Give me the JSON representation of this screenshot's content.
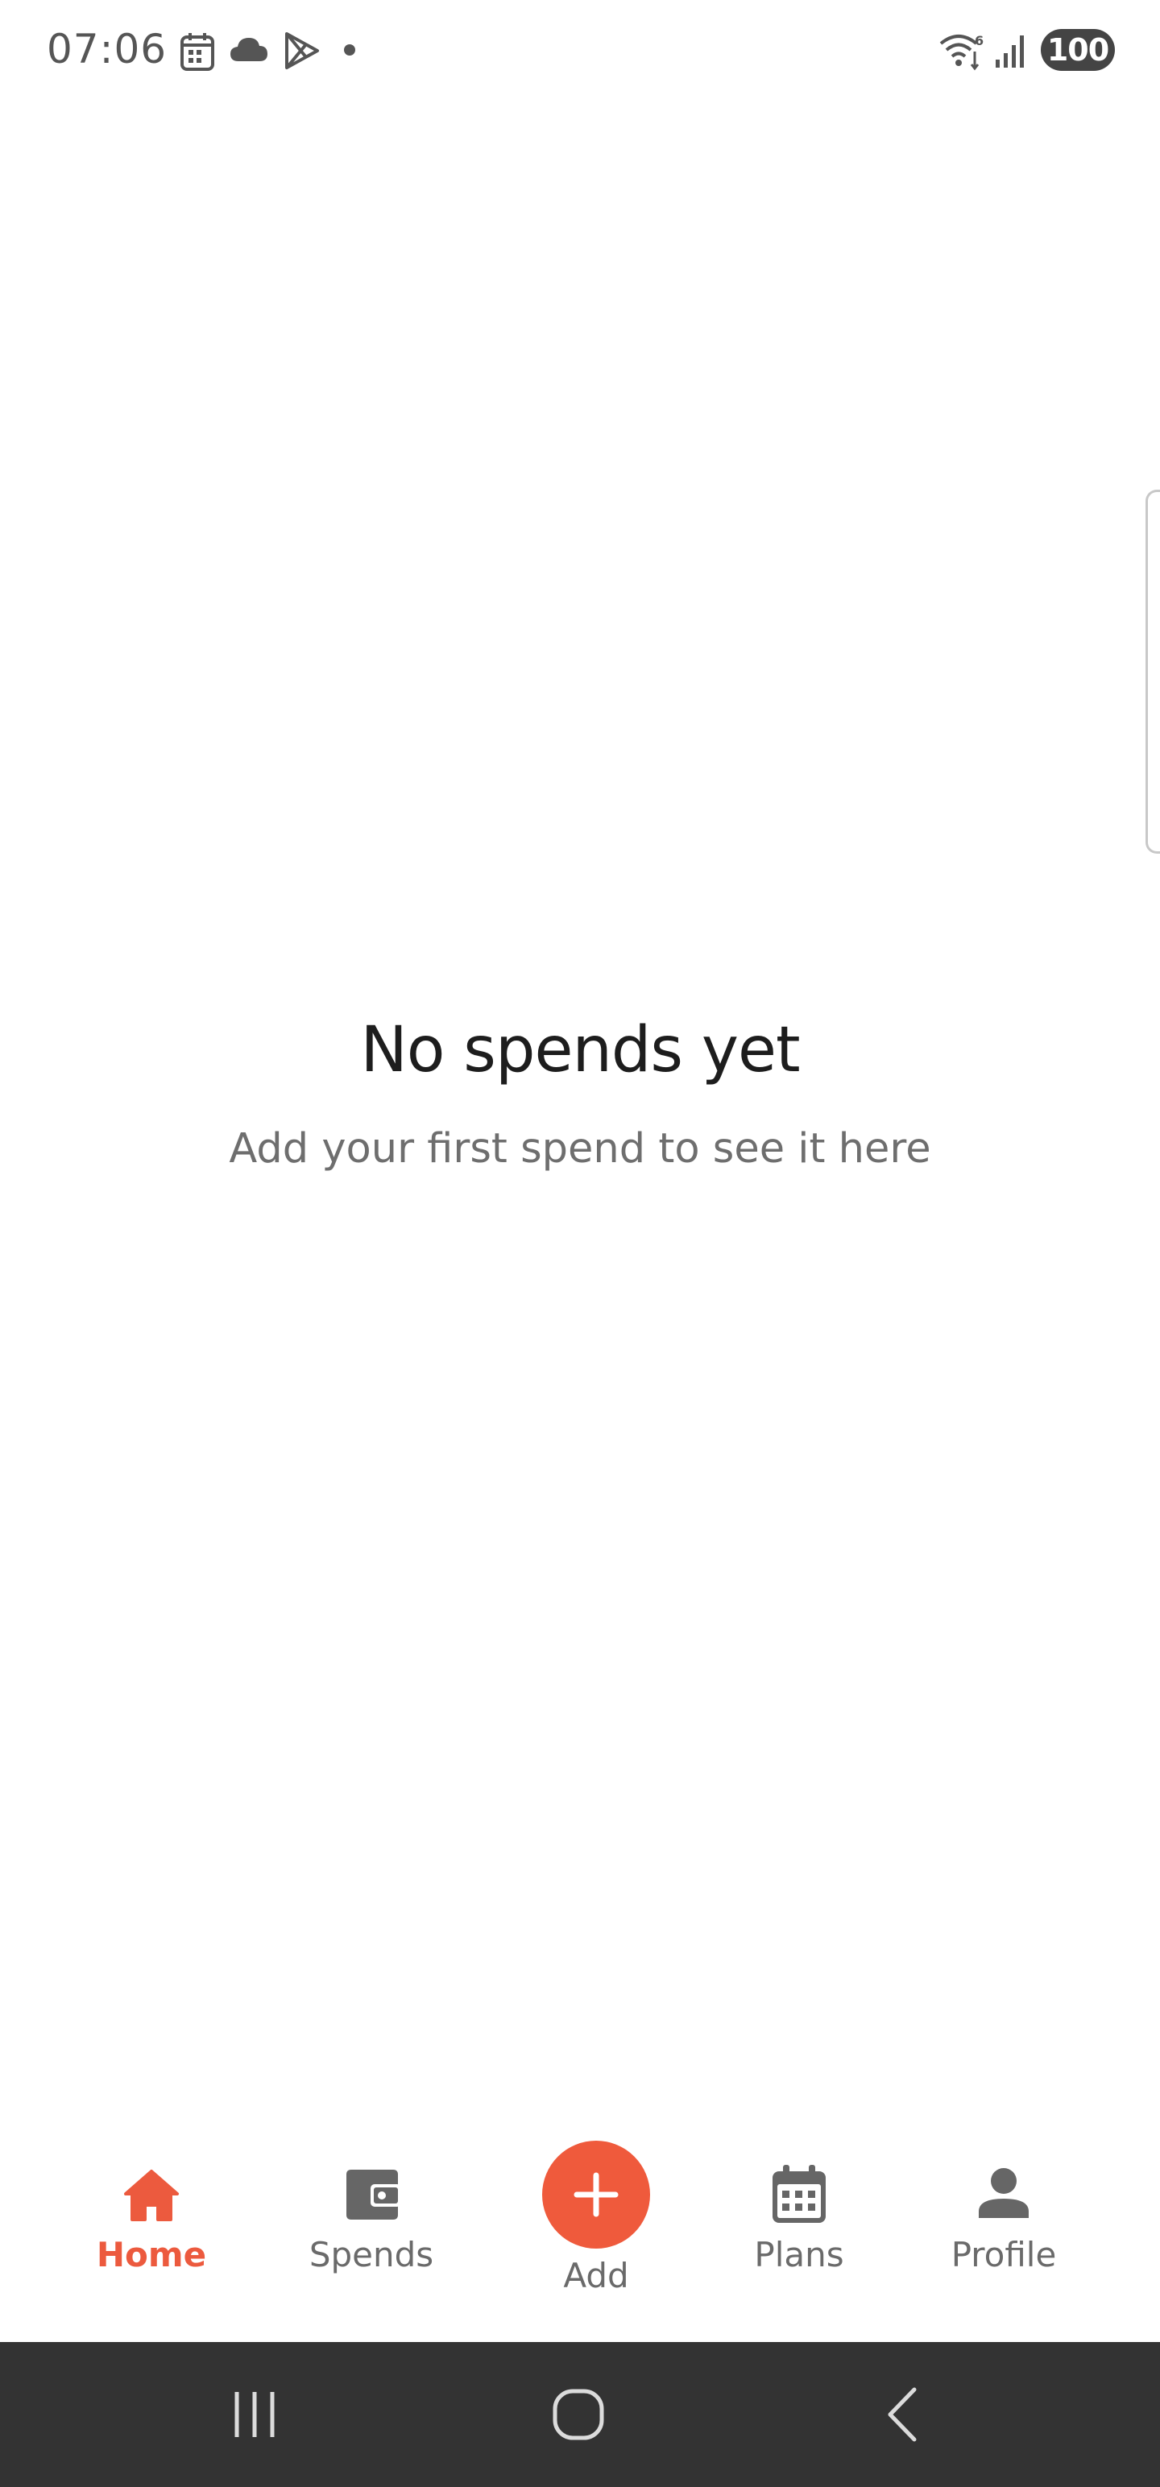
{
  "status_bar": {
    "time": "07:06",
    "battery": "100",
    "left_icons": [
      "calendar-icon",
      "cloud-icon",
      "play-store-icon",
      "dot-icon"
    ],
    "right_icons": [
      "wifi-icon",
      "signal-icon",
      "battery-icon"
    ]
  },
  "empty_state": {
    "title": "No spends yet",
    "subtitle": "Add your first spend to see it here"
  },
  "bottom_nav": {
    "active_color": "#ec5a3e",
    "inactive_color": "#6a6a6a",
    "items": [
      {
        "label": "Home",
        "icon": "home-icon",
        "active": true
      },
      {
        "label": "Spends",
        "icon": "wallet-icon",
        "active": false
      },
      {
        "label": "Add",
        "icon": "plus-icon",
        "active": false
      },
      {
        "label": "Plans",
        "icon": "calendar-icon",
        "active": false
      },
      {
        "label": "Profile",
        "icon": "person-icon",
        "active": false
      }
    ]
  },
  "system_nav": {
    "buttons": [
      "recents-icon",
      "home-button-icon",
      "back-icon"
    ]
  }
}
